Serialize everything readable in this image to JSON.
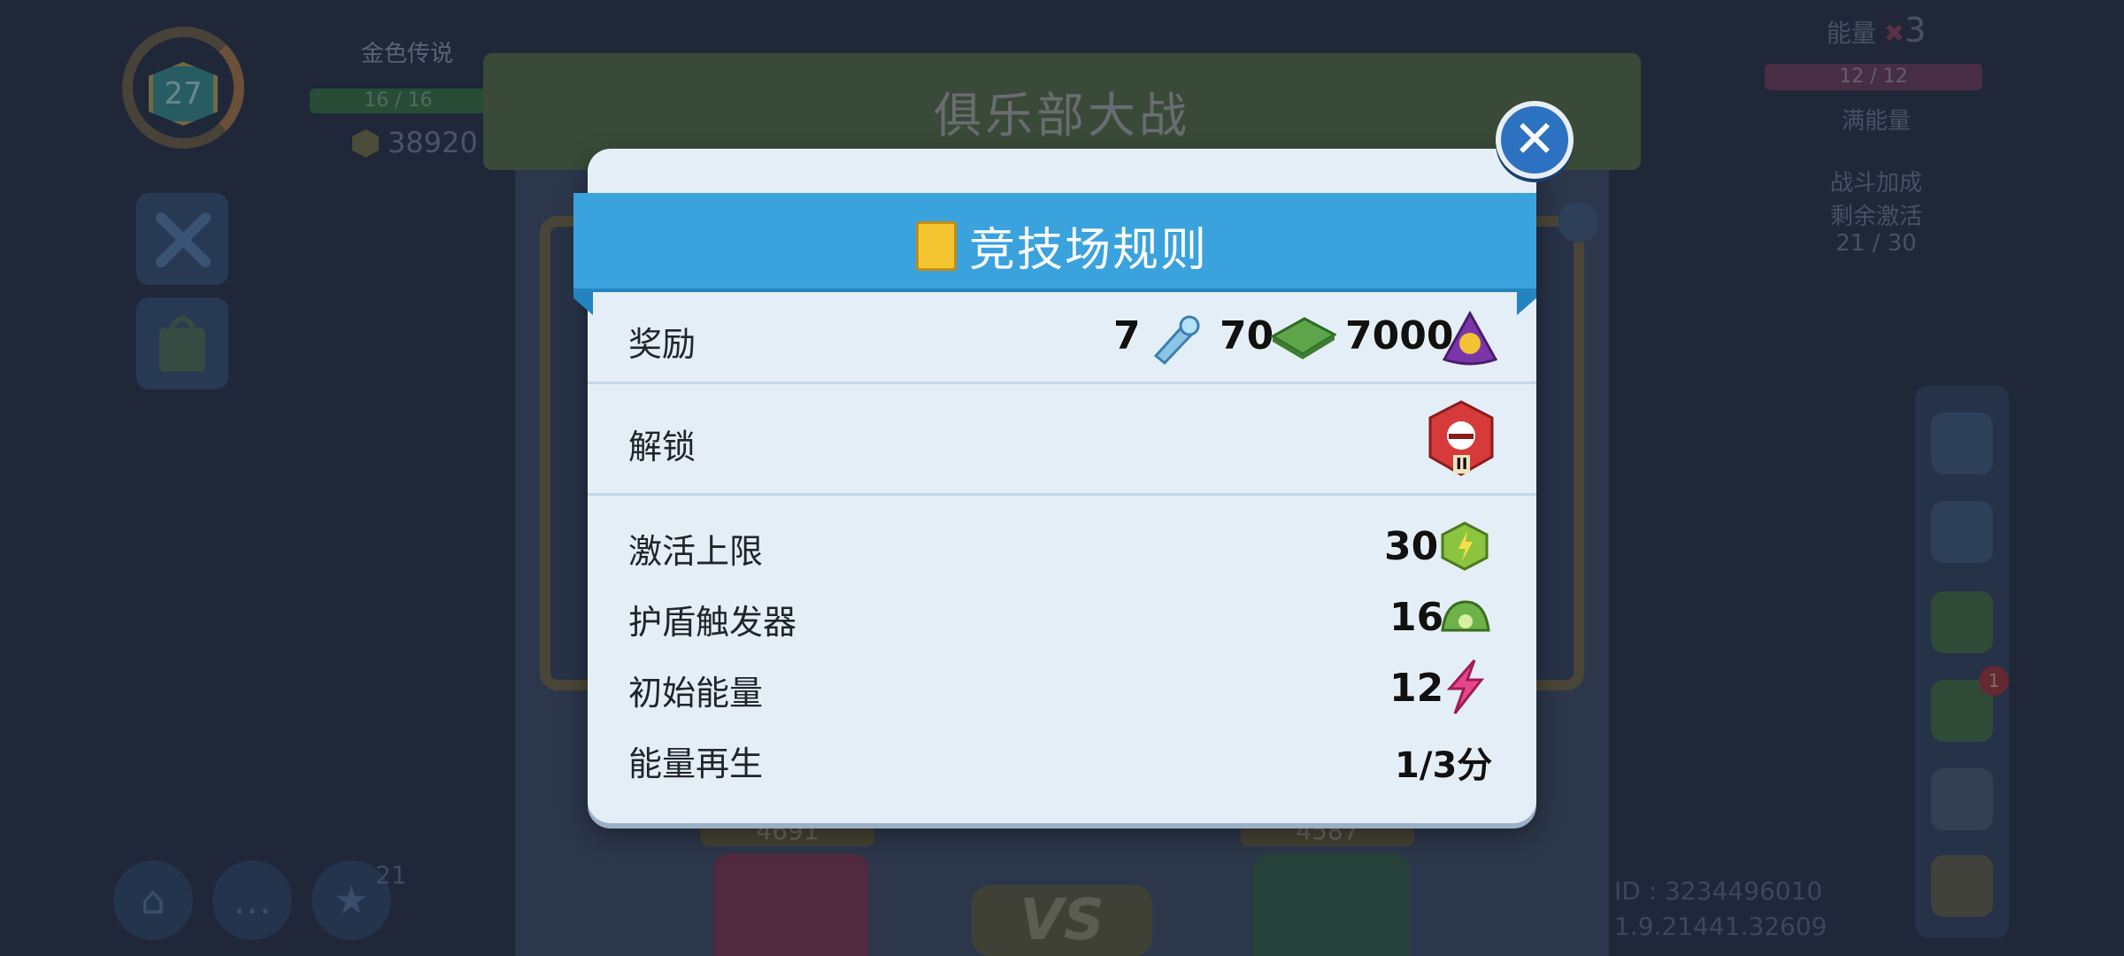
{
  "hud": {
    "level": "27",
    "rank_name": "金色传说",
    "xp": "16 / 16",
    "coins": "38920",
    "energy_label": "能量",
    "energy_mult": "3",
    "energy_bar": "12 / 12",
    "energy_status": "满能量",
    "battle_bonus": "战斗加成",
    "remaining_activation": "剩余激活",
    "activation_count": "21 / 30",
    "nav_badge_count": "21",
    "sidebar_badge": "1",
    "player_id": "ID : 3234496010",
    "version": "1.9.21441.32609"
  },
  "background": {
    "title": "俱乐部大战",
    "score_left": "4691",
    "score_right": "4587",
    "vs": "VS"
  },
  "dialog": {
    "title": "竞技场规则",
    "rows": [
      {
        "label": "奖励"
      },
      {
        "label": "解锁"
      },
      {
        "label": "激活上限",
        "value": "30"
      },
      {
        "label": "护盾触发器",
        "value": "16"
      },
      {
        "label": "初始能量",
        "value": "12"
      },
      {
        "label": "能量再生",
        "value": "1/3分"
      }
    ],
    "rewards": {
      "tokens": "7",
      "cash": "70",
      "gold": "7000"
    },
    "unlock_badge_rank": "II"
  },
  "colors": {
    "ribbon": "#3aa2dd",
    "close": "#2c72c0",
    "dialog_bg": "#e4eef7",
    "energy": "#e6468c"
  }
}
